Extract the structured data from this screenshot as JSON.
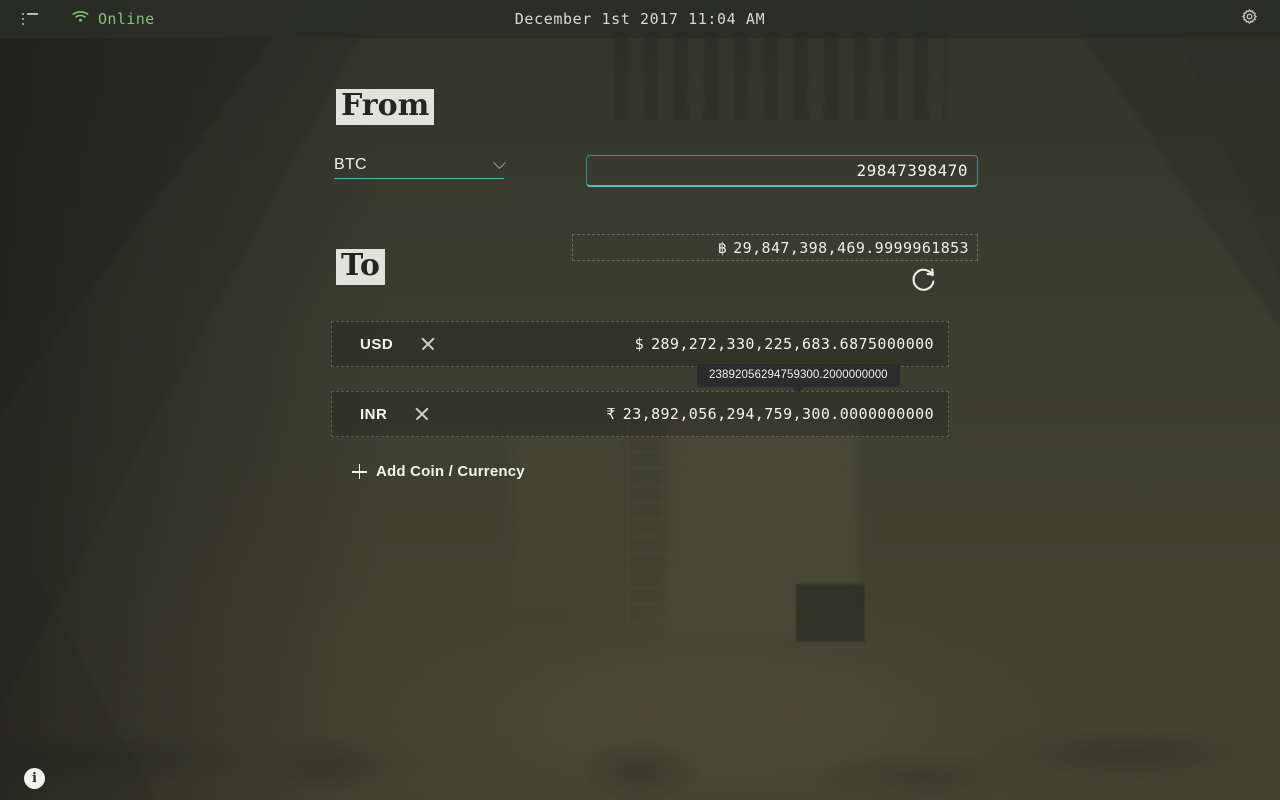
{
  "topbar": {
    "menu_icon": "list-icon",
    "wifi_icon": "wifi-icon",
    "status_label": "Online",
    "status_color": "#7bc96f",
    "clock": "December 1st 2017 11:04 AM",
    "settings_icon": "gear-icon"
  },
  "from": {
    "label": "From",
    "currency_selected": "BTC",
    "currency_options": [
      "BTC"
    ],
    "amount_value": "29847398470",
    "amount_placeholder": "",
    "readout_symbol": "฿",
    "readout_value": "29,847,398,469.9999961853",
    "accent_color": "#3fc9c6"
  },
  "to": {
    "label": "To",
    "refresh_icon": "refresh-icon",
    "rows": [
      {
        "code": "USD",
        "remove_icon": "close-icon",
        "symbol": "$",
        "value": "289,272,330,225,683.6875000000"
      },
      {
        "code": "INR",
        "remove_icon": "close-icon",
        "symbol": "₹",
        "value": "23,892,056,294,759,300.0000000000"
      }
    ],
    "tooltip": "23892056294759300.2000000000",
    "add_coin_label": "Add Coin / Currency",
    "add_icon": "plus-icon"
  },
  "footer": {
    "info_icon": "info-icon",
    "info_glyph": "i"
  }
}
